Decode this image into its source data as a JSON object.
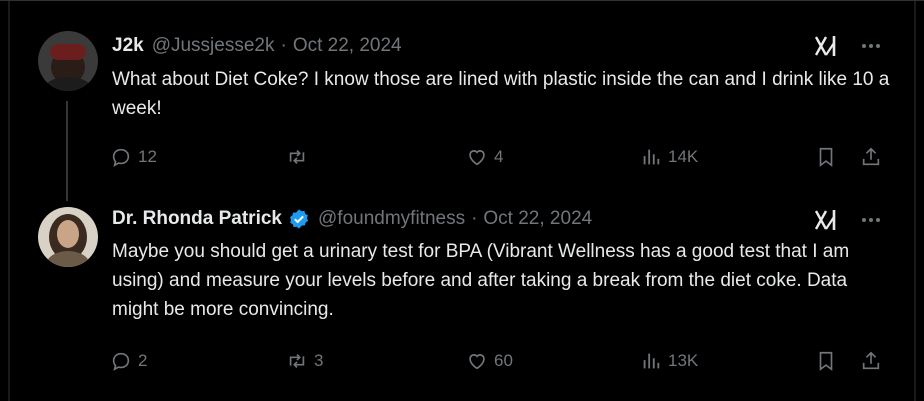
{
  "tweets": [
    {
      "name": "J2k",
      "handle": "@Jussjesse2k",
      "separator": "·",
      "date": "Oct 22, 2024",
      "text": "What about Diet Coke? I know those are lined with plastic inside the can and I drink like 10 a week!",
      "verified": false,
      "stats": {
        "replies": "12",
        "reposts": "",
        "likes": "4",
        "views": "14K"
      }
    },
    {
      "name": "Dr. Rhonda Patrick",
      "handle": "@foundmyfitness",
      "separator": "·",
      "date": "Oct 22, 2024",
      "text": "Maybe you should get a urinary test for BPA (Vibrant Wellness has a good test that I am using) and measure your levels before and after taking a break from the diet coke. Data might be more convincing.",
      "verified": true,
      "stats": {
        "replies": "2",
        "reposts": "3",
        "likes": "60",
        "views": "13K"
      }
    }
  ],
  "colors": {
    "background": "#000000",
    "text": "#e7e9ea",
    "muted": "#71767b",
    "verified": "#1d9bf0",
    "divider": "#2f3336"
  },
  "icons": [
    "reply-icon",
    "repost-icon",
    "like-icon",
    "views-icon",
    "bookmark-icon",
    "share-icon",
    "grok-icon",
    "more-icon",
    "verified-badge-icon"
  ]
}
